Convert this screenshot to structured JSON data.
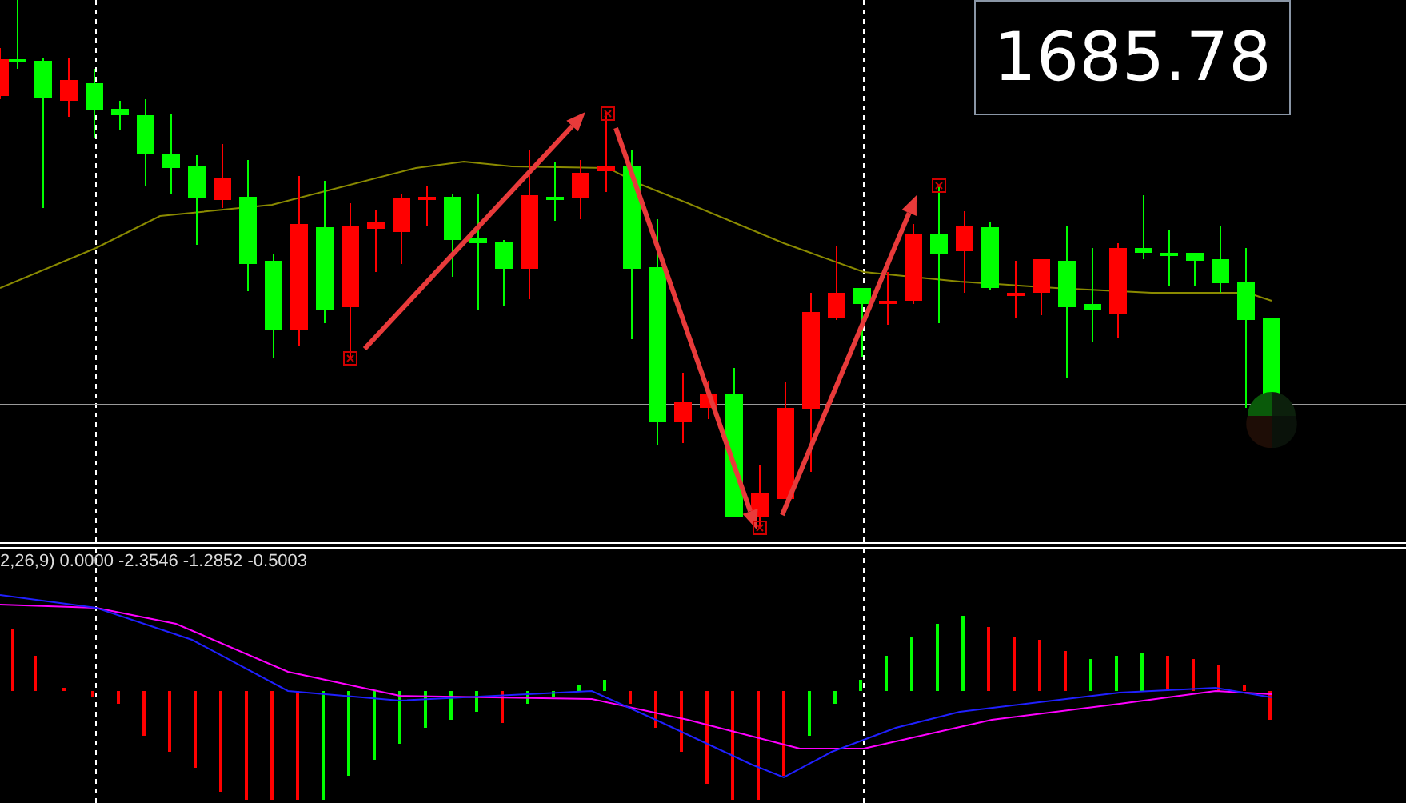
{
  "price_chart": {
    "current_price": "1685.78"
  },
  "indicator_panel": {
    "label": "2,26,9) 0.0000 -2.3546 -1.2852 -0.5003"
  }
}
